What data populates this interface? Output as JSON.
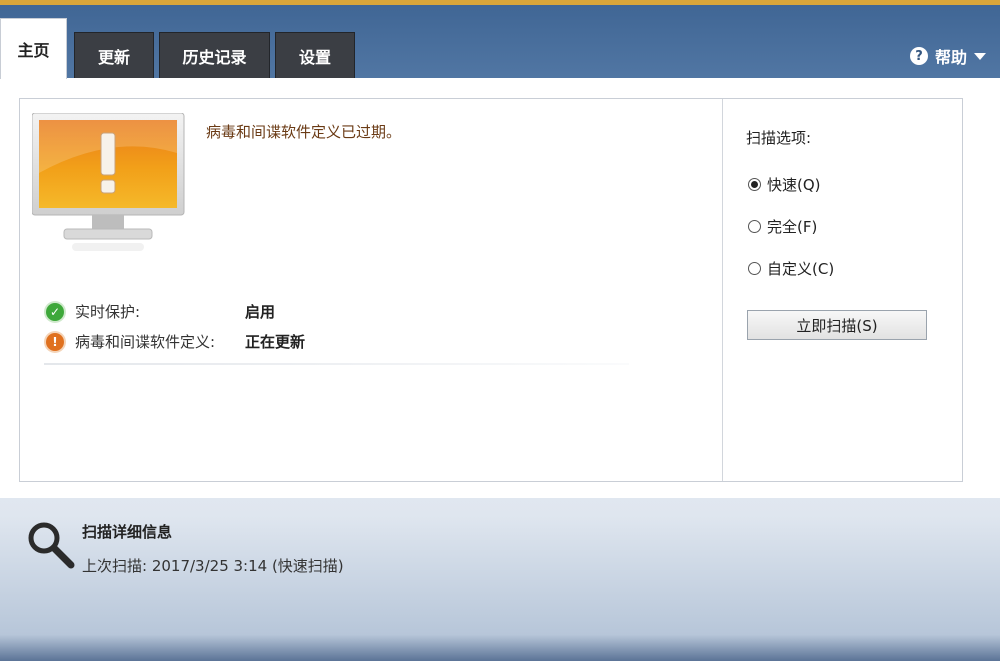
{
  "tabs": [
    {
      "label": "主页",
      "active": true
    },
    {
      "label": "更新",
      "active": false
    },
    {
      "label": "历史记录",
      "active": false
    },
    {
      "label": "设置",
      "active": false
    }
  ],
  "help": {
    "label": "帮助",
    "icon": "question-circle-icon"
  },
  "alert_message": "病毒和间谍软件定义已过期。",
  "status": [
    {
      "icon": "check-circle-icon",
      "label": "实时保护:",
      "value": "启用"
    },
    {
      "icon": "warning-circle-icon",
      "label": "病毒和间谍软件定义:",
      "value": "正在更新"
    }
  ],
  "scan_options": {
    "title": "扫描选项:",
    "options": [
      {
        "label": "快速(Q)",
        "checked": true
      },
      {
        "label": "完全(F)",
        "checked": false
      },
      {
        "label": "自定义(C)",
        "checked": false
      }
    ],
    "button_label": "立即扫描(S)"
  },
  "scan_details": {
    "title": "扫描详细信息",
    "last_scan": "上次扫描: 2017/3/25 3:14 (快速扫描)"
  },
  "colors": {
    "accent": "#d9a53a",
    "monitor_orange": "#f29a1e",
    "ok_green": "#3ea83a",
    "warn_orange": "#e0711f"
  }
}
